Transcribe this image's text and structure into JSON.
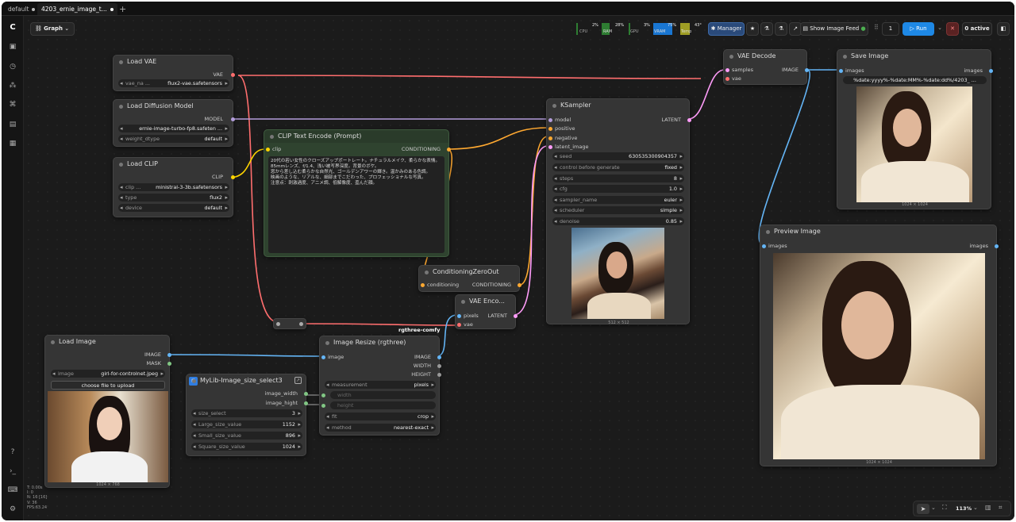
{
  "tabs": [
    {
      "label": "default"
    },
    {
      "label": "4203_ernie_image_t..."
    }
  ],
  "toolbar": {
    "graph_label": "Graph",
    "cpu_pct": "2%",
    "cpu_label": "CPU",
    "ram_pct": "28%",
    "ram_label": "RAM",
    "gpu_pct": "3%",
    "gpu_label": "GPU",
    "vram_pct": "75%",
    "vram_label": "VRAM",
    "temp_pct": "43°",
    "temp_label": "Temp",
    "manager": "Manager",
    "show_feed": "Show Image Feed",
    "queue_count": "1",
    "run": "Run",
    "active": "0 active"
  },
  "nodes": {
    "load_vae": {
      "title": "Load VAE",
      "out": "VAE",
      "w_label": "vae_na ...",
      "w_value": "flux2-vae.safetensors"
    },
    "load_diffusion": {
      "title": "Load Diffusion Model",
      "out": "MODEL",
      "w1_value": "ernie-image-turbo-fp8.safeten ...",
      "w2_label": "weight_dtype",
      "w2_value": "default"
    },
    "load_clip": {
      "title": "Load CLIP",
      "out": "CLIP",
      "w1_label": "clip ...",
      "w1_value": "ministral-3-3b.safetensors",
      "w2_label": "type",
      "w2_value": "flux2",
      "w3_label": "device",
      "w3_value": "default"
    },
    "clip_text": {
      "title": "CLIP Text Encode (Prompt)",
      "in": "clip",
      "out": "CONDITIONING",
      "text": "20代の若い女性のクローズアップポートレート。ナチュラルメイク、柔らかな表情。\n85mmレンズ、f/1.4、浅い被写界深度。背景のボケ。\n窓から差し込む柔らかな自然光、ゴールデンアワーの輝き。温かみのある色調。\n映画のような、リアルな、細部までこだわった、プロフェッショナルな写真。\n注意点：刺激過度、アニメ調、低解像度、歪んだ顔。"
    },
    "cond_zero": {
      "title": "ConditioningZeroOut",
      "in": "conditioning",
      "out": "CONDITIONING"
    },
    "vae_encode": {
      "title": "VAE Enco...",
      "in1": "pixels",
      "in2": "vae",
      "out": "LATENT"
    },
    "ksampler": {
      "title": "KSampler",
      "in1": "model",
      "in2": "positive",
      "in3": "negative",
      "in4": "latent_image",
      "out": "LATENT",
      "widgets": [
        {
          "label": "seed",
          "value": "630535300904357"
        },
        {
          "label": "control before generate",
          "value": "fixed"
        },
        {
          "label": "steps",
          "value": "8"
        },
        {
          "label": "cfg",
          "value": "1.0"
        },
        {
          "label": "sampler_name",
          "value": "euler"
        },
        {
          "label": "scheduler",
          "value": "simple"
        },
        {
          "label": "denoise",
          "value": "0.85"
        }
      ],
      "caption": "512 × 512"
    },
    "vae_decode": {
      "title": "VAE Decode",
      "in1": "samples",
      "in2": "vae",
      "out": "IMAGE"
    },
    "save_image": {
      "title": "Save Image",
      "in": "images",
      "out": "images",
      "prefix": "%date:yyyy%-%date:MM%-%date:dd%/4203_ ...",
      "caption": "1024 × 1024"
    },
    "preview_image": {
      "title": "Preview Image",
      "in": "images",
      "out": "images",
      "caption": "1024 × 1024"
    },
    "load_image": {
      "title": "Load Image",
      "out1": "IMAGE",
      "out2": "MASK",
      "w_label": "image",
      "w_value": "girl-for-controlnet.jpeg",
      "upload": "choose file to upload",
      "caption": "1024 × 768"
    },
    "image_resize": {
      "title": "Image Resize (rgthree)",
      "badge": "rgthree-comfy",
      "in": "image",
      "out1": "IMAGE",
      "out2": "WIDTH",
      "out3": "HEIGHT",
      "w1_label": "measurement",
      "w1_value": "pixels",
      "w2": "width",
      "w3": "height",
      "w4_label": "fit",
      "w4_value": "crop",
      "w5_label": "method",
      "w5_value": "nearest-exact"
    },
    "mylib": {
      "title": "MyLib-Image_size_select3",
      "out1": "image_width",
      "out2": "image_hight",
      "widgets": [
        {
          "label": "size_select",
          "value": "3"
        },
        {
          "label": "Large_size_value",
          "value": "1152"
        },
        {
          "label": "Small_size_value",
          "value": "896"
        },
        {
          "label": "Square_size_value",
          "value": "1024"
        }
      ]
    }
  },
  "stats": {
    "t": "T: 0.00s",
    "i": "I: 0",
    "n": "N: 16 [16]",
    "v": "V: 36",
    "fps": "FPS:63.24"
  },
  "zoom": "113%"
}
